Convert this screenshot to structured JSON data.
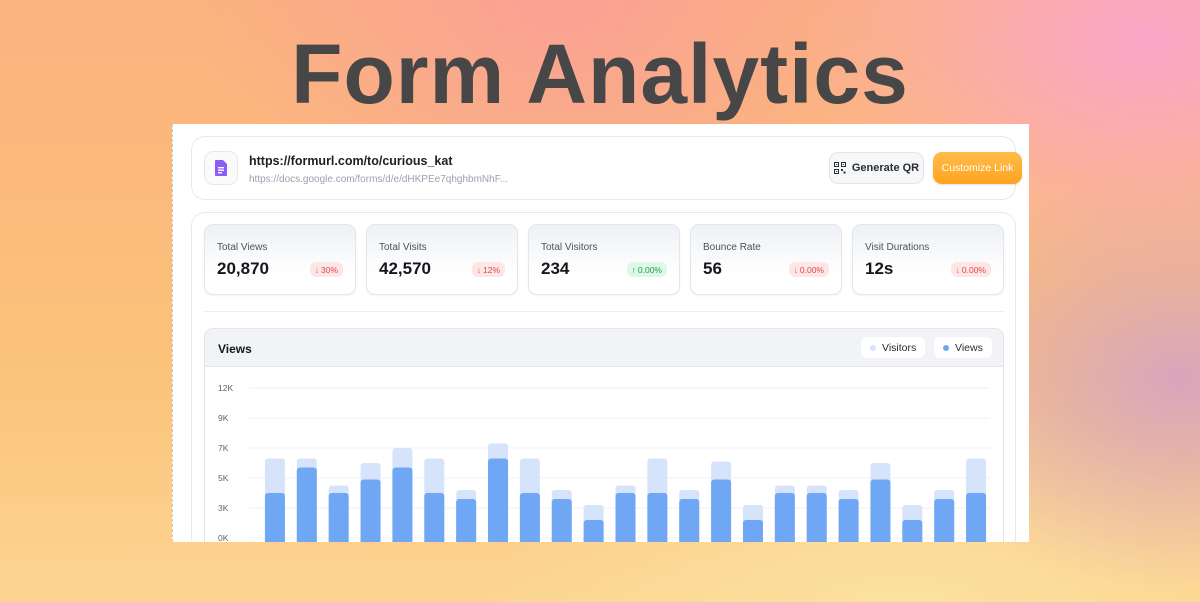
{
  "hero": {
    "title": "Form Analytics"
  },
  "link": {
    "short_url": "https://formurl.com/to/curious_kat",
    "source_url": "https://docs.google.com/forms/d/e/dHKPEe7qhghbmNhF...",
    "icon": "document-icon",
    "icon_color": "#8b5cf6"
  },
  "actions": {
    "generate_qr": "Generate QR",
    "customize_link": "Customize Link",
    "accent": "#ffa31f"
  },
  "stats": [
    {
      "label": "Total Views",
      "value": "20,870",
      "change": "30%",
      "direction": "down"
    },
    {
      "label": "Total Visits",
      "value": "42,570",
      "change": "12%",
      "direction": "down"
    },
    {
      "label": "Total Visitors",
      "value": "234",
      "change": "0.00%",
      "direction": "up"
    },
    {
      "label": "Bounce Rate",
      "value": "56",
      "change": "0.00%",
      "direction": "down"
    },
    {
      "label": "Visit Durations",
      "value": "12s",
      "change": "0.00%",
      "direction": "down"
    }
  ],
  "chart": {
    "title": "Views",
    "legend": [
      {
        "name": "Visitors",
        "color": "#d6e4fb"
      },
      {
        "name": "Views",
        "color": "#6fa7f5"
      }
    ]
  },
  "chart_data": {
    "type": "bar",
    "title": "Views",
    "y_ticks": [
      "12K",
      "9K",
      "7K",
      "5K",
      "3K",
      "0K"
    ],
    "y_tick_values": [
      10,
      8,
      6,
      4,
      2,
      0
    ],
    "ylim": [
      0,
      10
    ],
    "grid": true,
    "legend_position": "top-right",
    "series": [
      {
        "name": "Visitors",
        "color": "#d6e4fb",
        "values": [
          5.3,
          5.3,
          3.5,
          5.0,
          6.0,
          5.3,
          3.2,
          6.3,
          5.3,
          3.2,
          2.2,
          3.5,
          5.3,
          3.2,
          5.1,
          2.2,
          3.5,
          3.5,
          3.2,
          5.0,
          2.2,
          3.2,
          5.3
        ]
      },
      {
        "name": "Views",
        "color": "#6fa7f5",
        "values": [
          3.0,
          4.7,
          3.0,
          3.9,
          4.7,
          3.0,
          2.6,
          5.3,
          3.0,
          2.6,
          1.2,
          3.0,
          3.0,
          2.6,
          3.9,
          1.2,
          3.0,
          3.0,
          2.6,
          3.9,
          1.2,
          2.6,
          3.0
        ]
      }
    ]
  }
}
